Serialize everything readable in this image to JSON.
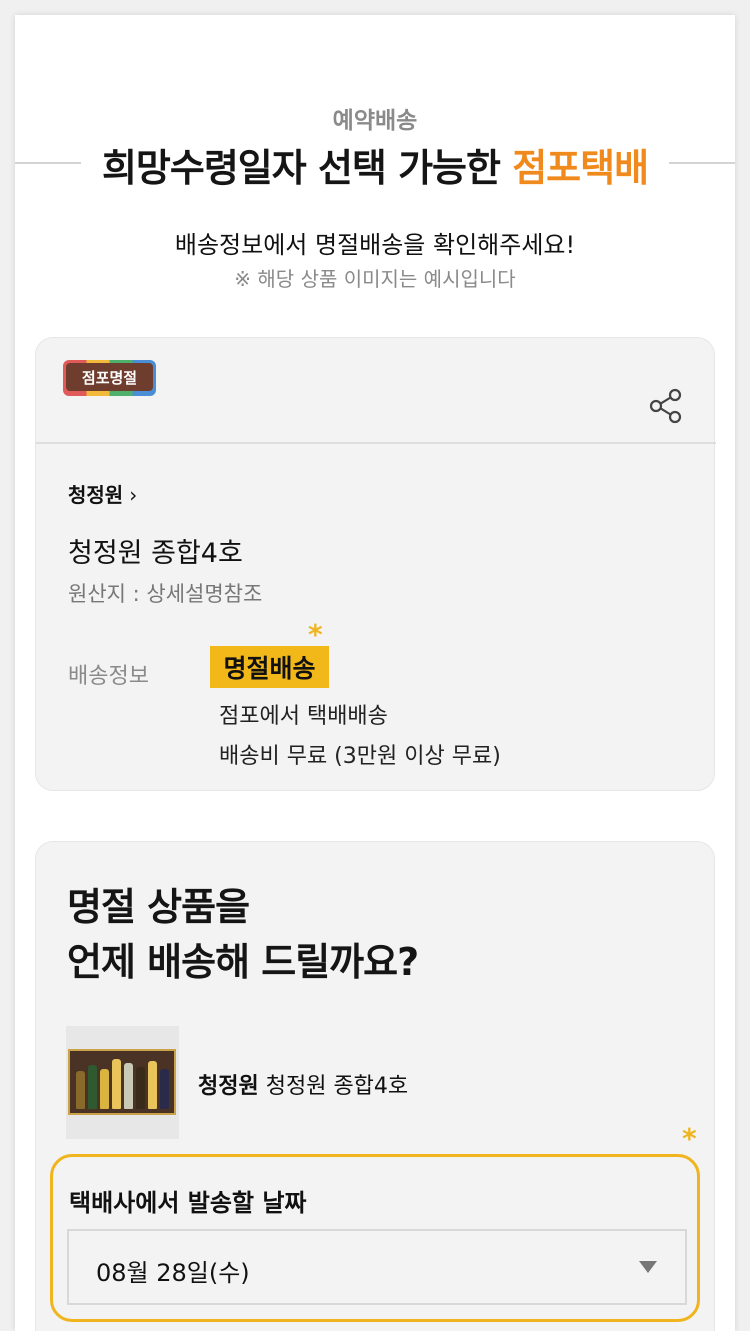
{
  "header": {
    "eyebrow": "예약배송",
    "headline_main": "희망수령일자 선택 가능한 ",
    "headline_accent": "점포택배",
    "subline": "배송정보에서 명절배송을 확인해주세요!",
    "note": "※ 해당 상품 이미지는 예시입니다"
  },
  "product_card": {
    "tag_label": "점포명절",
    "share_icon": "share-icon",
    "brand": "청정원",
    "brand_chevron": "›",
    "product_name": "청정원 종합4호",
    "origin": "원산지 : 상세설명참조",
    "shipping_label": "배송정보",
    "shipping_badge": "명절배송",
    "shipping_line1": "점포에서 택배배송",
    "shipping_line2": "배송비 무료 (3만원 이상 무료)",
    "marker": "*"
  },
  "delivery_card": {
    "question_line1": "명절 상품을",
    "question_line2": "언제 배송해 드릴까요?",
    "product_brand": "청정원",
    "product_name": " 청정원 종합4호",
    "marker": "*",
    "date_label": "택배사에서 발송할 날짜",
    "date_value": "08월 28일(수)",
    "caret_icon": "dropdown-caret-icon"
  },
  "colors": {
    "accent_orange": "#f08a1d",
    "highlight_yellow": "#f2b81a",
    "border_yellow": "#f0b41e"
  }
}
